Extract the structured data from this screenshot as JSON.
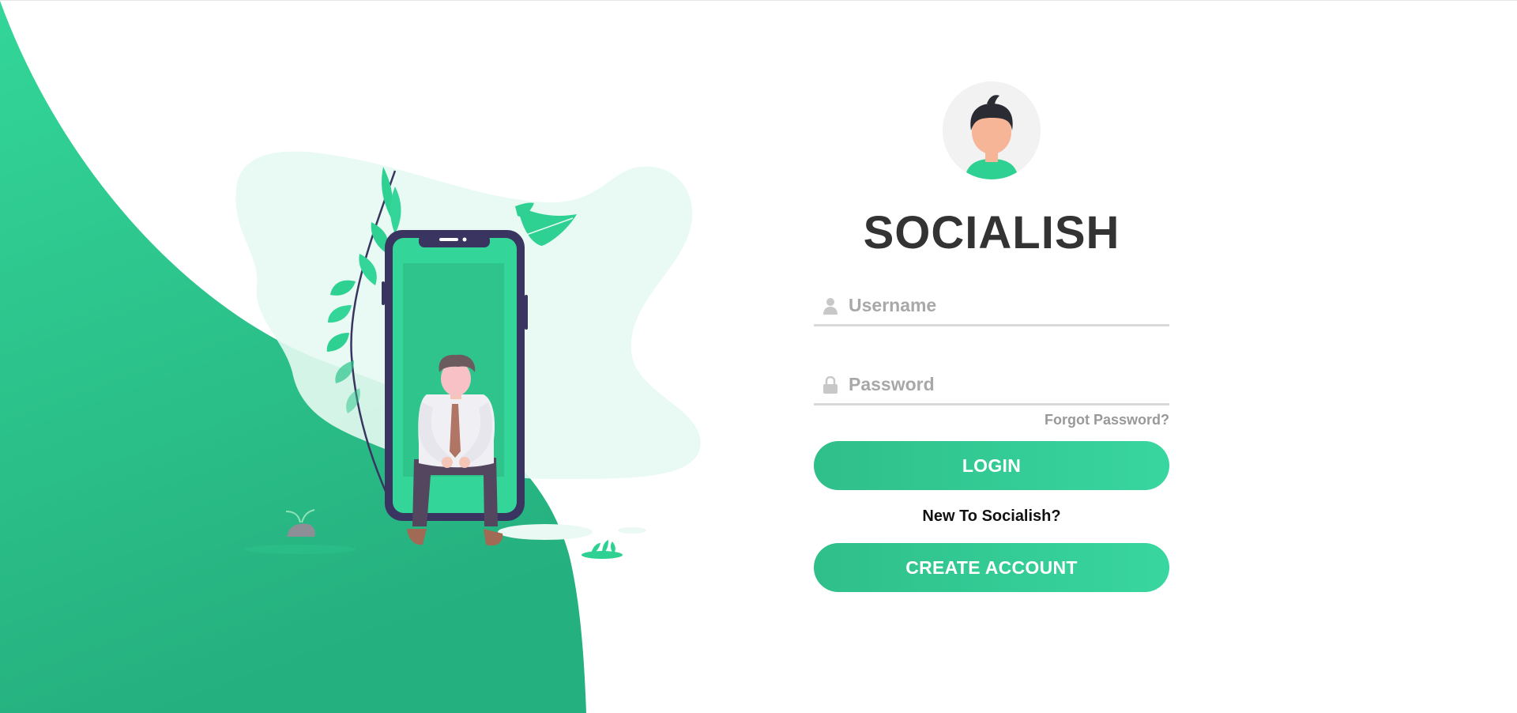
{
  "app": {
    "brand_title": "SOCIALISH"
  },
  "form": {
    "username_placeholder": "Username",
    "username_value": "",
    "password_placeholder": "Password",
    "password_value": "",
    "forgot_label": "Forgot Password?",
    "login_label": "LOGIN",
    "new_prompt": "New To Socialish?",
    "create_label": "CREATE ACCOUNT"
  },
  "icons": {
    "username": "user-icon",
    "password": "lock-icon",
    "avatar": "avatar-icon"
  },
  "colors": {
    "accent": "#2fd193",
    "accent_dark": "#25b07d",
    "phone_frame": "#3a3460",
    "title": "#333333",
    "muted": "#a8a8a8"
  }
}
